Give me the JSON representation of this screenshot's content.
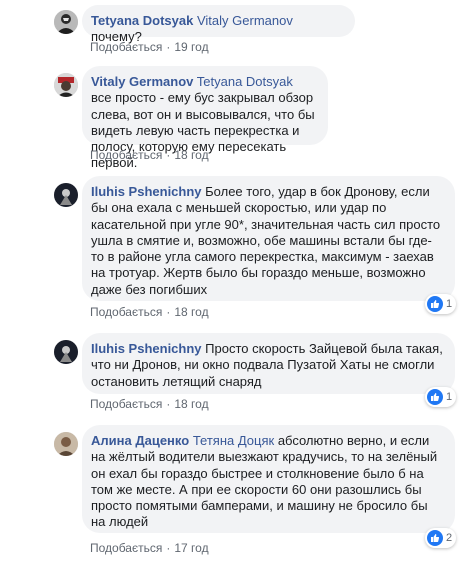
{
  "comments": [
    {
      "author": "Tetyana Dotsyak",
      "mention": "Vitaly Germanov",
      "text": " почему?",
      "like_label": "Подобається",
      "dot": "·",
      "time": "19 год"
    },
    {
      "author": "Vitaly Germanov",
      "mention": "Tetyana Dotsyak",
      "text": " все просто - ему бус закрывал обзор слева, вот он и высовывался, что бы видеть левую часть перекрестка и полосу, которую ему пересекать первой.",
      "like_label": "Подобається",
      "dot": "·",
      "time": "18 год"
    },
    {
      "author": "Iluhis Pshenichny",
      "mention": "",
      "text": " Более того, удар в бок Дронову, если бы она ехала с меньшей скоростью, или удар по касательной при угле 90*, значительная часть сил просто ушла в смятие и, возможно, обе машины встали бы где-то в районе угла самого перекрестка, максимум - заехав на тротуар. Жертв было бы гораздо меньше, возможно даже без погибших",
      "like_label": "Подобається",
      "dot": "·",
      "time": "18 год",
      "reaction_count": "1"
    },
    {
      "author": "Iluhis Pshenichny",
      "mention": "",
      "text": " Просто скорость Зайцевой была такая, что ни Дронов, ни окно подвала Пузатой Хаты не смогли остановить летящий снаряд",
      "like_label": "Подобається",
      "dot": "·",
      "time": "18 год",
      "reaction_count": "1"
    },
    {
      "author": "Алина Даценко",
      "mention": "Тетяна Доцяк",
      "text": " абсолютно верно, и если на жёлтый водители выезжают крадучись, то на зелёный он ехал бы гораздо быстрее и столкновение было б на том же месте. А при ее скорости 60 они разошлись бы просто помятыми бамперами, и машину не бросило бы на людей",
      "like_label": "Подобається",
      "dot": "·",
      "time": "17 год",
      "reaction_count": "2"
    }
  ],
  "colors": {
    "author": "#385898",
    "bubble": "#f2f3f5",
    "meta": "#606770",
    "like_badge": "#2078f4"
  },
  "icons": [
    "avatar",
    "like-icon"
  ]
}
